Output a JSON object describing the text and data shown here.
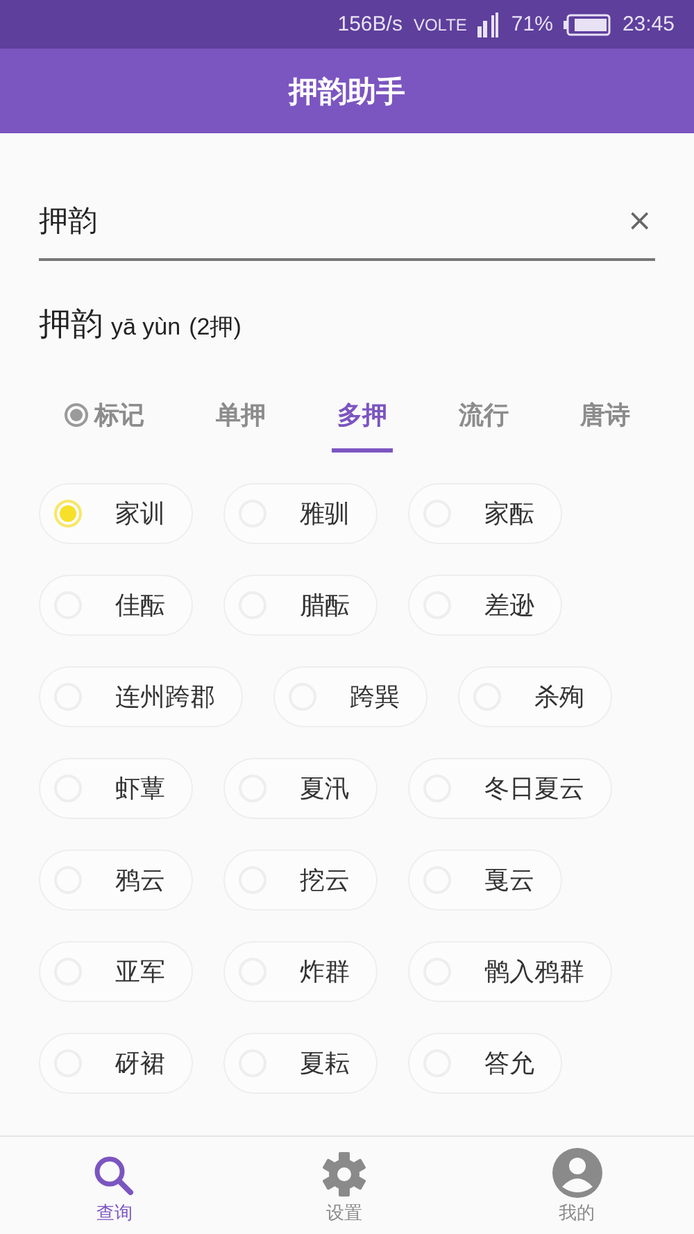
{
  "status_bar": {
    "speed": "156B/s",
    "network": "VOLTE",
    "battery": "71%",
    "time": "23:45"
  },
  "app_bar": {
    "title": "押韵助手"
  },
  "search": {
    "value": "押韵",
    "clear": "×"
  },
  "result": {
    "word": "押韵",
    "pinyin": "yā yùn",
    "count": "(2押)"
  },
  "tabs": [
    {
      "kind": "mark",
      "label": "标记",
      "selected": false
    },
    {
      "kind": "tab",
      "label": "单押",
      "selected": false
    },
    {
      "kind": "tab",
      "label": "多押",
      "selected": true
    },
    {
      "kind": "tab",
      "label": "流行",
      "selected": false
    },
    {
      "kind": "tab",
      "label": "唐诗",
      "selected": false
    }
  ],
  "rhymes": [
    {
      "label": "家训",
      "selected": true
    },
    {
      "label": "雅驯",
      "selected": false
    },
    {
      "label": "家酝",
      "selected": false
    },
    {
      "label": "佳酝",
      "selected": false
    },
    {
      "label": "腊酝",
      "selected": false
    },
    {
      "label": "差逊",
      "selected": false
    },
    {
      "label": "连州跨郡",
      "selected": false
    },
    {
      "label": "跨巽",
      "selected": false
    },
    {
      "label": "杀殉",
      "selected": false
    },
    {
      "label": "虾蕈",
      "selected": false
    },
    {
      "label": "夏汛",
      "selected": false
    },
    {
      "label": "冬日夏云",
      "selected": false
    },
    {
      "label": "鸦云",
      "selected": false
    },
    {
      "label": "挖云",
      "selected": false
    },
    {
      "label": "戛云",
      "selected": false
    },
    {
      "label": "亚军",
      "selected": false
    },
    {
      "label": "炸群",
      "selected": false
    },
    {
      "label": "鹘入鸦群",
      "selected": false
    },
    {
      "label": "砑裙",
      "selected": false
    },
    {
      "label": "夏耘",
      "selected": false
    },
    {
      "label": "答允",
      "selected": false
    }
  ],
  "bottom_nav": [
    {
      "kind": "search",
      "label": "查询",
      "selected": true
    },
    {
      "kind": "settings",
      "label": "设置",
      "selected": false
    },
    {
      "kind": "profile",
      "label": "我的",
      "selected": false
    }
  ]
}
